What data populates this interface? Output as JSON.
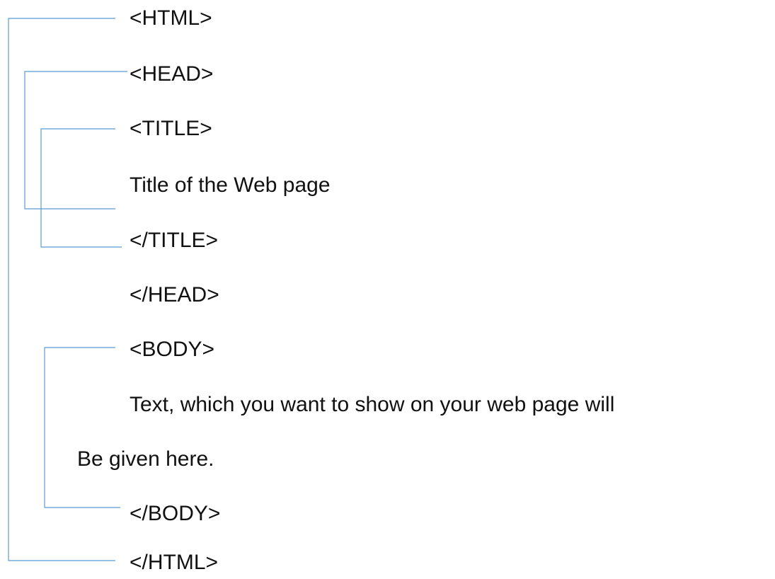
{
  "lines": [
    "<HTML>",
    "<HEAD>",
    "<TITLE>",
    "Title of the Web page",
    "</TITLE>",
    "</HEAD>",
    "<BODY>",
    "Text, which you want to show on your web page will",
    "Be given here.",
    "</BODY>",
    "</HTML>"
  ],
  "connector_color": "#5B9BD5",
  "text_color": "#111111"
}
